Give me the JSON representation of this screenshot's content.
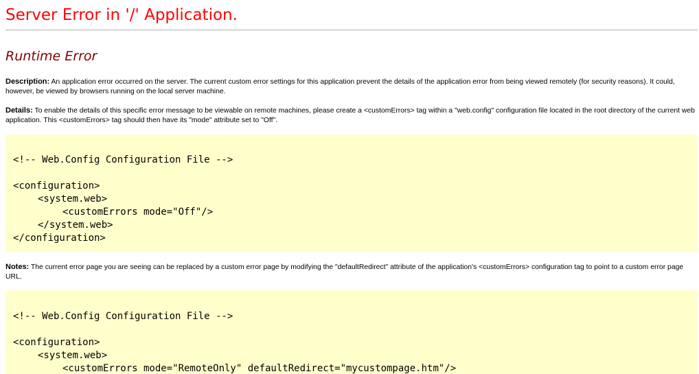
{
  "page": {
    "title": "Server Error in '/' Application.",
    "subtitle": "Runtime Error",
    "description": {
      "label": "Description:",
      "text": " An application error occurred on the server. The current custom error settings for this application prevent the details of the application error from being viewed remotely (for security reasons). It could, however, be viewed by browsers running on the local server machine."
    },
    "details": {
      "label": "Details:",
      "text": " To enable the details of this specific error message to be viewable on remote machines, please create a <customErrors> tag within a \"web.config\" configuration file located in the root directory of the current web application. This <customErrors> tag should then have its \"mode\" attribute set to \"Off\"."
    },
    "notes": {
      "label": "Notes:",
      "text": " The current error page you are seeing can be replaced by a custom error page by modifying the \"defaultRedirect\" attribute of the application's <customErrors> configuration tag to point to a custom error page URL."
    },
    "code_block_1": {
      "comment": "<!-- Web.Config Configuration File -->",
      "open_config": "<configuration>",
      "open_system_web": "<system.web>",
      "custom_errors": "<customErrors mode=\"Off\"/>",
      "close_system_web": "</system.web>",
      "close_config": "</configuration>"
    },
    "code_block_2": {
      "comment": "<!-- Web.Config Configuration File -->",
      "open_config": "<configuration>",
      "open_system_web": "<system.web>",
      "custom_errors": "<customErrors mode=\"RemoteOnly\" defaultRedirect=\"mycustompage.htm\"/>"
    }
  },
  "colors": {
    "title": "#ff0000",
    "subtitle": "#800000",
    "code_background": "#ffffcc"
  }
}
